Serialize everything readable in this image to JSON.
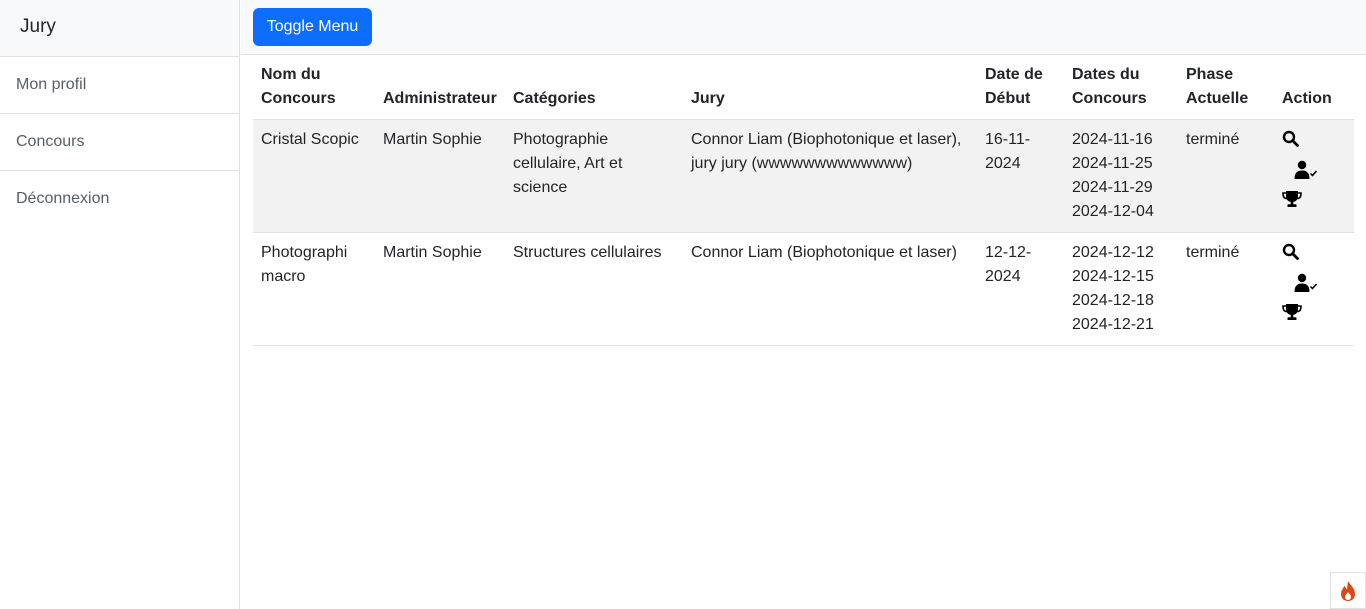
{
  "sidebar": {
    "heading": "Jury",
    "items": [
      {
        "label": "Mon profil"
      },
      {
        "label": "Concours"
      },
      {
        "label": "Déconnexion"
      }
    ]
  },
  "topbar": {
    "toggle_label": "Toggle Menu"
  },
  "table": {
    "headers": {
      "nom": "Nom du Concours",
      "admin": "Administrateur",
      "categories": "Catégories",
      "jury": "Jury",
      "date_debut": "Date de Début",
      "dates": "Dates du Concours",
      "phase": "Phase Actuelle",
      "action": "Action"
    },
    "rows": [
      {
        "nom": "Cristal Scopic",
        "admin": "Martin Sophie",
        "categories": "Photographie cellulaire, Art et science",
        "jury": "Connor Liam (Biophotonique et laser), jury jury (wwwwwwwwwwwww)",
        "date_debut": "16-11-2024",
        "dates": [
          "2024-11-16",
          "2024-11-25",
          "2024-11-29",
          "2024-12-04"
        ],
        "phase": "terminé",
        "actions": [
          "search-icon",
          "user-check-icon",
          "trophy-icon"
        ]
      },
      {
        "nom": "Photographi macro",
        "admin": "Martin Sophie",
        "categories": "Structures cellulaires",
        "jury": "Connor Liam (Biophotonique et laser)",
        "date_debut": "12-12-2024",
        "dates": [
          "2024-12-12",
          "2024-12-15",
          "2024-12-18",
          "2024-12-21"
        ],
        "phase": "terminé",
        "actions": [
          "search-icon",
          "user-check-icon",
          "trophy-icon"
        ]
      }
    ]
  },
  "colors": {
    "primary": "#0d6efd",
    "stripe": "#f2f2f2",
    "topbar_bg": "#f8f9fa",
    "fire": "#dd4814"
  },
  "badge": {
    "icon": "flame-icon"
  }
}
